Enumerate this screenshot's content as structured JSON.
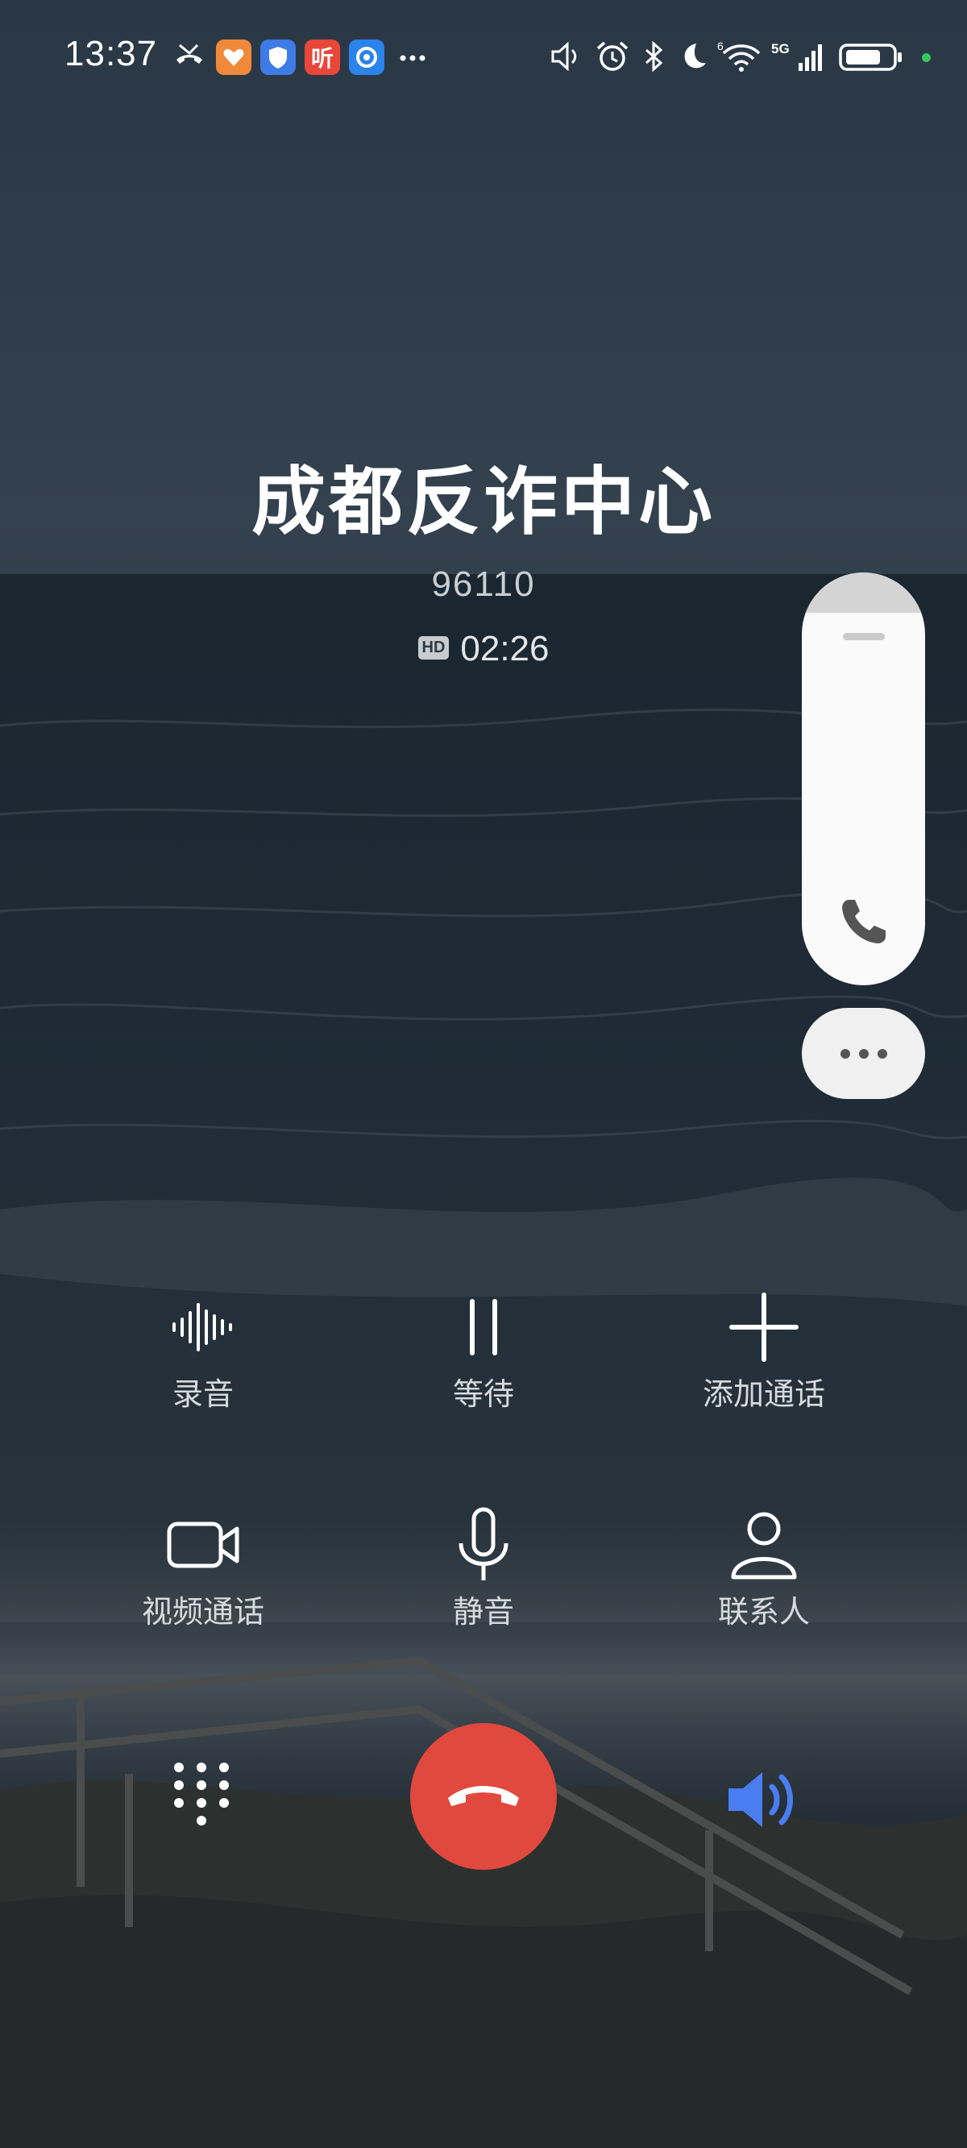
{
  "status_bar": {
    "time": "13:37",
    "app_tile_listen": "听",
    "network_small": "6",
    "network_gen": "5G",
    "icons": [
      "missed-call-icon",
      "app-health-icon",
      "app-shield-icon",
      "app-listen-icon",
      "app-browser-icon",
      "more-icon",
      "volume-icon",
      "alarm-icon",
      "bluetooth-icon",
      "do-not-disturb-icon",
      "wifi-icon",
      "signal-5g-icon",
      "battery-icon",
      "privacy-dot-icon"
    ]
  },
  "call": {
    "name": "成都反诈中心",
    "number": "96110",
    "hd_badge": "HD",
    "duration": "02:26"
  },
  "controls": {
    "record": "录音",
    "hold": "等待",
    "add_call": "添加通话",
    "video_call": "视频通话",
    "mute": "静音",
    "contacts": "联系人"
  },
  "colors": {
    "end_call": "#e2493e",
    "speaker_active": "#4a7ef0",
    "floating_panel": "#fafafa"
  }
}
